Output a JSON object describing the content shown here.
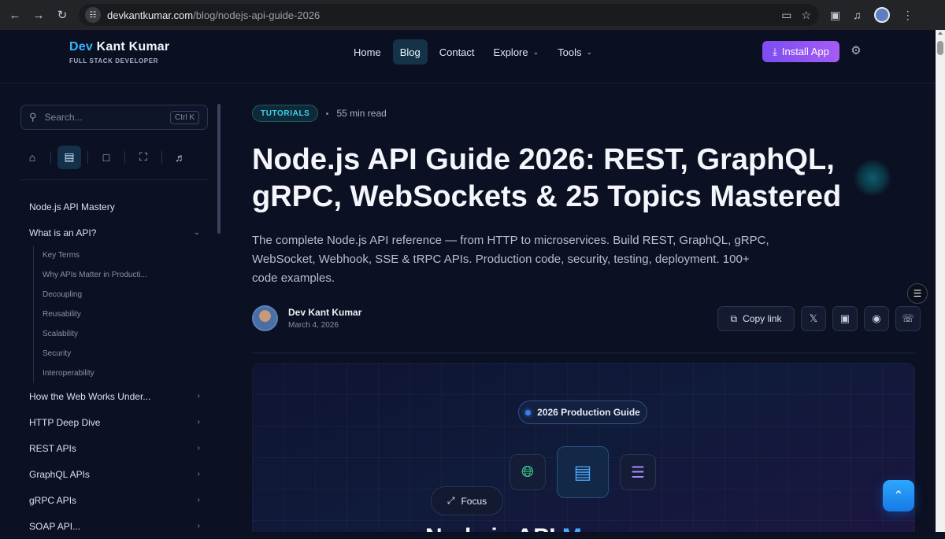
{
  "browser": {
    "url_host": "devkantkumar.com",
    "url_path": "/blog/nodejs-api-guide-2026"
  },
  "header": {
    "brand_first": "Dev",
    "brand_rest": " Kant Kumar",
    "tagline": "FULL STACK DEVELOPER",
    "nav": {
      "home": "Home",
      "blog": "Blog",
      "contact": "Contact",
      "explore": "Explore",
      "tools": "Tools"
    },
    "install_label": "Install App"
  },
  "sidebar": {
    "search_placeholder": "Search...",
    "search_shortcut": "Ctrl K",
    "toc": {
      "root": "Node.js API Mastery",
      "what_is_api": "What is an API?",
      "sub_items": [
        "Key Terms",
        "Why APIs Matter in Producti...",
        "Decoupling",
        "Reusability",
        "Scalability",
        "Security",
        "Interoperability"
      ],
      "sections": [
        "How the Web Works Under...",
        "HTTP Deep Dive",
        "REST APIs",
        "GraphQL APIs",
        "gRPC APIs",
        "SOAP API..."
      ]
    }
  },
  "article": {
    "category": "TUTORIALS",
    "read_time": "55 min read",
    "title": "Node.js API Guide 2026: REST, GraphQL, gRPC, WebSockets & 25 Topics Mastered",
    "subtitle": "The complete Node.js API reference — from HTTP to microservices. Build REST, GraphQL, gRPC, WebSocket, Webhook, SSE & tRPC APIs. Production code, security, testing, deployment. 100+ code examples.",
    "author_name": "Dev Kant Kumar",
    "date": "March 4, 2026",
    "copy_link_label": "Copy link"
  },
  "hero": {
    "badge": "2026 Production Guide",
    "focus_label": "Focus",
    "heading_peek_main": "Node.js API ",
    "heading_peek_accent": "M"
  },
  "colors": {
    "accent": "#35b6ff",
    "install_gradient_start": "#7d4df2",
    "install_gradient_end": "#a45cf4",
    "badge_text": "#3dd0ee",
    "back_to_top": "#1f8ff2"
  },
  "icons": {
    "back": "back-arrow-icon",
    "forward": "forward-arrow-icon",
    "reload": "reload-icon",
    "search": "search-icon",
    "settings": "gear-icon",
    "download": "download-icon",
    "home": "home-icon",
    "article": "article-icon",
    "bookmark": "bookmark-icon",
    "fullscreen": "fullscreen-icon",
    "speaker": "speaker-icon",
    "copy": "copy-icon",
    "x": "x-logo-icon",
    "linkedin": "linkedin-icon",
    "reddit": "reddit-icon",
    "whatsapp": "whatsapp-icon",
    "globe": "globe-icon",
    "server": "server-icon",
    "layers": "layers-icon",
    "expand": "expand-icon",
    "chevron_up": "chevron-up-icon"
  }
}
